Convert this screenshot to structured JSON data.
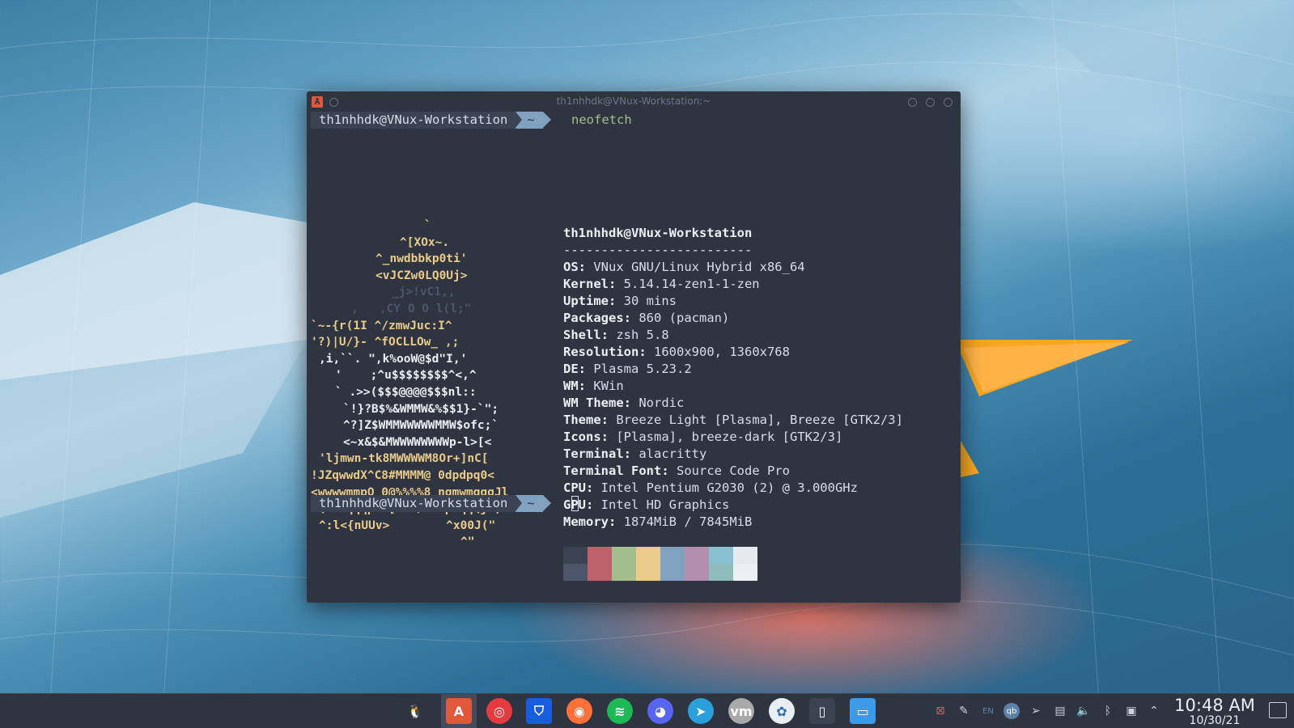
{
  "terminal": {
    "title": "th1nhhdk@VNux-Workstation:~",
    "prompt_user": "th1nhhdk@VNux-Workstation",
    "prompt_dir": "~",
    "command": "neofetch",
    "info_header": "th1nhhdk@VNux-Workstation",
    "info_separator": "-------------------------",
    "info": [
      {
        "label": "OS",
        "value": "VNux GNU/Linux Hybrid x86_64"
      },
      {
        "label": "Kernel",
        "value": "5.14.14-zen1-1-zen"
      },
      {
        "label": "Uptime",
        "value": "30 mins"
      },
      {
        "label": "Packages",
        "value": "860 (pacman)"
      },
      {
        "label": "Shell",
        "value": "zsh 5.8"
      },
      {
        "label": "Resolution",
        "value": "1600x900, 1360x768"
      },
      {
        "label": "DE",
        "value": "Plasma 5.23.2"
      },
      {
        "label": "WM",
        "value": "KWin"
      },
      {
        "label": "WM Theme",
        "value": "Nordic"
      },
      {
        "label": "Theme",
        "value": "Breeze Light [Plasma], Breeze [GTK2/3]"
      },
      {
        "label": "Icons",
        "value": "[Plasma], breeze-dark [GTK2/3]"
      },
      {
        "label": "Terminal",
        "value": "alacritty"
      },
      {
        "label": "Terminal Font",
        "value": "Source Code Pro"
      },
      {
        "label": "CPU",
        "value": "Intel Pentium G2030 (2) @ 3.000GHz"
      },
      {
        "label": "GPU",
        "value": "Intel HD Graphics"
      },
      {
        "label": "Memory",
        "value": "1874MiB / 7845MiB"
      }
    ],
    "ascii_art": [
      {
        "text": "`",
        "color": "y"
      },
      {
        "text": "^[XOx~.",
        "color": "y"
      },
      {
        "text": "^_nwdbbkp0ti'",
        "color": "y"
      },
      {
        "text": "<vJCZw0LQ0Uj>",
        "color": "y"
      },
      {
        "text": "_j>!vC1,,",
        "color": "d"
      },
      {
        "text": ",   ,CY O O l(l;\"",
        "color": "d"
      },
      {
        "text": "`~-{r(1I ^/zmwJuc:I^",
        "color": "y"
      },
      {
        "text": "'?)|U/}- ^fOCLLOw_ ,;",
        "color": "y"
      },
      {
        "text": ",i,``. \",k%ooW@$d\"I,'",
        "color": "w"
      },
      {
        "text": "'    ;^u$$$$$$$$^<,^",
        "color": "w"
      },
      {
        "text": "` .>>($$$@@@@$$$nl::",
        "color": "w"
      },
      {
        "text": "`!}?B$%&WMMW&%$$1}-`\";",
        "color": "w"
      },
      {
        "text": "^?]Z$WMMWWWWWMMW$ofc;`",
        "color": "w"
      },
      {
        "text": "<~x&$&MWWWWWWWWp-l>[<",
        "color": "w"
      },
      {
        "text": "'ljmwn-tk8MWWWWM8Or+]nC[",
        "color": "y"
      },
      {
        "text": "!JZqwwdX^C8#MMMM@ 0dpdpq0<",
        "color": "y"
      },
      {
        "text": "<wwwwmmpO 0@%%%%8 nqmwmqqqJl",
        "color": "y"
      },
      {
        "text": "?QOZmqqqpbt[run/?!0pwqqQj-,",
        "color": "y"
      },
      {
        "text": "^:l<{nUUv>        ^x00J(\"",
        "color": "y"
      },
      {
        "text": "^\"",
        "color": "y"
      }
    ],
    "palette_top": [
      "#3b4252",
      "#bf616a",
      "#a3be8c",
      "#ebcb8b",
      "#81a1c1",
      "#b48ead",
      "#88c0d0",
      "#e5e9f0"
    ],
    "palette_bottom": [
      "#4c566a",
      "#bf616a",
      "#a3be8c",
      "#ebcb8b",
      "#81a1c1",
      "#b48ead",
      "#8fbcbb",
      "#eceff4"
    ]
  },
  "taskbar": {
    "apps": [
      {
        "name": "tux-icon",
        "glyph": "🐧",
        "color": "#2e3440"
      },
      {
        "name": "alacritty-icon",
        "glyph": "A",
        "color": "#e0573a"
      },
      {
        "name": "authy-icon",
        "glyph": "◎",
        "color": "#e53a40"
      },
      {
        "name": "bitwarden-icon",
        "glyph": "⛉",
        "color": "#175ddc"
      },
      {
        "name": "firefox-icon",
        "glyph": "◉",
        "color": "#ff7139"
      },
      {
        "name": "spotify-icon",
        "glyph": "≋",
        "color": "#1db954"
      },
      {
        "name": "discord-icon",
        "glyph": "◕",
        "color": "#5865f2"
      },
      {
        "name": "telegram-icon",
        "glyph": "➤",
        "color": "#2aa0da"
      },
      {
        "name": "vmware-icon",
        "glyph": "vm",
        "color": "#a9a9a9"
      },
      {
        "name": "krita-icon",
        "glyph": "✿",
        "color": "#e8eef2"
      },
      {
        "name": "kdeconnect-icon",
        "glyph": "▯",
        "color": "#3b4252"
      },
      {
        "name": "files-icon",
        "glyph": "▭",
        "color": "#3d9ae8"
      }
    ],
    "tray": [
      {
        "name": "error-tray-icon",
        "glyph": "⊠"
      },
      {
        "name": "brush-tray-icon",
        "glyph": "✎"
      },
      {
        "name": "keyboard-layout-tray-icon",
        "glyph": "EN"
      },
      {
        "name": "qbittorrent-tray-icon",
        "glyph": "qb"
      },
      {
        "name": "telegram-tray-icon",
        "glyph": "➢"
      },
      {
        "name": "clipboard-tray-icon",
        "glyph": "▤"
      },
      {
        "name": "volume-tray-icon",
        "glyph": "🔈"
      },
      {
        "name": "bluetooth-tray-icon",
        "glyph": "ᛒ"
      },
      {
        "name": "network-tray-icon",
        "glyph": "▣"
      },
      {
        "name": "expand-tray-icon",
        "glyph": "⌃"
      }
    ],
    "time": "10:48 AM",
    "date": "10/30/21"
  }
}
